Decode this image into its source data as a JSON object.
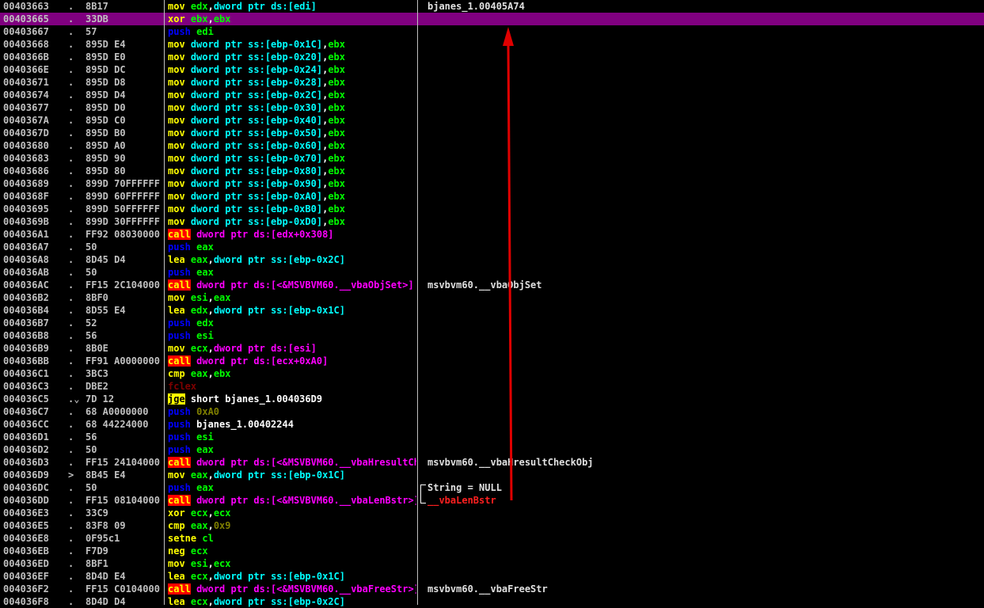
{
  "rows": [
    {
      "addr": "00403663",
      "mark": ".",
      "hex": "8B17",
      "asm": [
        [
          "mov ",
          "mov"
        ],
        [
          "edx",
          "reg"
        ],
        [
          ",",
          "plain"
        ],
        [
          "dword ptr ds:[edi]",
          "mem"
        ]
      ],
      "cmt": [
        [
          "bjanes_1.00405A74",
          "cmt"
        ]
      ]
    },
    {
      "addr": "00403665",
      "mark": ".",
      "hex": "33DB",
      "sel": true,
      "asm": [
        [
          "xor ",
          "mov"
        ],
        [
          "ebx",
          "reg"
        ],
        [
          ",",
          "plain"
        ],
        [
          "ebx",
          "reg"
        ]
      ],
      "cmt": []
    },
    {
      "addr": "00403667",
      "mark": ".",
      "hex": "57",
      "asm": [
        [
          "push ",
          "push"
        ],
        [
          "edi",
          "reg"
        ]
      ],
      "cmt": []
    },
    {
      "addr": "00403668",
      "mark": ".",
      "hex": "895D E4",
      "asm": [
        [
          "mov ",
          "mov"
        ],
        [
          "dword ptr ss:[ebp-0x1C]",
          "mem"
        ],
        [
          ",",
          "plain"
        ],
        [
          "ebx",
          "reg"
        ]
      ],
      "cmt": []
    },
    {
      "addr": "0040366B",
      "mark": ".",
      "hex": "895D E0",
      "asm": [
        [
          "mov ",
          "mov"
        ],
        [
          "dword ptr ss:[ebp-0x20]",
          "mem"
        ],
        [
          ",",
          "plain"
        ],
        [
          "ebx",
          "reg"
        ]
      ],
      "cmt": []
    },
    {
      "addr": "0040366E",
      "mark": ".",
      "hex": "895D DC",
      "asm": [
        [
          "mov ",
          "mov"
        ],
        [
          "dword ptr ss:[ebp-0x24]",
          "mem"
        ],
        [
          ",",
          "plain"
        ],
        [
          "ebx",
          "reg"
        ]
      ],
      "cmt": []
    },
    {
      "addr": "00403671",
      "mark": ".",
      "hex": "895D D8",
      "asm": [
        [
          "mov ",
          "mov"
        ],
        [
          "dword ptr ss:[ebp-0x28]",
          "mem"
        ],
        [
          ",",
          "plain"
        ],
        [
          "ebx",
          "reg"
        ]
      ],
      "cmt": []
    },
    {
      "addr": "00403674",
      "mark": ".",
      "hex": "895D D4",
      "asm": [
        [
          "mov ",
          "mov"
        ],
        [
          "dword ptr ss:[ebp-0x2C]",
          "mem"
        ],
        [
          ",",
          "plain"
        ],
        [
          "ebx",
          "reg"
        ]
      ],
      "cmt": []
    },
    {
      "addr": "00403677",
      "mark": ".",
      "hex": "895D D0",
      "asm": [
        [
          "mov ",
          "mov"
        ],
        [
          "dword ptr ss:[ebp-0x30]",
          "mem"
        ],
        [
          ",",
          "plain"
        ],
        [
          "ebx",
          "reg"
        ]
      ],
      "cmt": []
    },
    {
      "addr": "0040367A",
      "mark": ".",
      "hex": "895D C0",
      "asm": [
        [
          "mov ",
          "mov"
        ],
        [
          "dword ptr ss:[ebp-0x40]",
          "mem"
        ],
        [
          ",",
          "plain"
        ],
        [
          "ebx",
          "reg"
        ]
      ],
      "cmt": []
    },
    {
      "addr": "0040367D",
      "mark": ".",
      "hex": "895D B0",
      "asm": [
        [
          "mov ",
          "mov"
        ],
        [
          "dword ptr ss:[ebp-0x50]",
          "mem"
        ],
        [
          ",",
          "plain"
        ],
        [
          "ebx",
          "reg"
        ]
      ],
      "cmt": []
    },
    {
      "addr": "00403680",
      "mark": ".",
      "hex": "895D A0",
      "asm": [
        [
          "mov ",
          "mov"
        ],
        [
          "dword ptr ss:[ebp-0x60]",
          "mem"
        ],
        [
          ",",
          "plain"
        ],
        [
          "ebx",
          "reg"
        ]
      ],
      "cmt": []
    },
    {
      "addr": "00403683",
      "mark": ".",
      "hex": "895D 90",
      "asm": [
        [
          "mov ",
          "mov"
        ],
        [
          "dword ptr ss:[ebp-0x70]",
          "mem"
        ],
        [
          ",",
          "plain"
        ],
        [
          "ebx",
          "reg"
        ]
      ],
      "cmt": []
    },
    {
      "addr": "00403686",
      "mark": ".",
      "hex": "895D 80",
      "asm": [
        [
          "mov ",
          "mov"
        ],
        [
          "dword ptr ss:[ebp-0x80]",
          "mem"
        ],
        [
          ",",
          "plain"
        ],
        [
          "ebx",
          "reg"
        ]
      ],
      "cmt": []
    },
    {
      "addr": "00403689",
      "mark": ".",
      "hex": "899D 70FFFFFF",
      "asm": [
        [
          "mov ",
          "mov"
        ],
        [
          "dword ptr ss:[ebp-0x90]",
          "mem"
        ],
        [
          ",",
          "plain"
        ],
        [
          "ebx",
          "reg"
        ]
      ],
      "cmt": []
    },
    {
      "addr": "0040368F",
      "mark": ".",
      "hex": "899D 60FFFFFF",
      "asm": [
        [
          "mov ",
          "mov"
        ],
        [
          "dword ptr ss:[ebp-0xA0]",
          "mem"
        ],
        [
          ",",
          "plain"
        ],
        [
          "ebx",
          "reg"
        ]
      ],
      "cmt": []
    },
    {
      "addr": "00403695",
      "mark": ".",
      "hex": "899D 50FFFFFF",
      "asm": [
        [
          "mov ",
          "mov"
        ],
        [
          "dword ptr ss:[ebp-0xB0]",
          "mem"
        ],
        [
          ",",
          "plain"
        ],
        [
          "ebx",
          "reg"
        ]
      ],
      "cmt": []
    },
    {
      "addr": "0040369B",
      "mark": ".",
      "hex": "899D 30FFFFFF",
      "asm": [
        [
          "mov ",
          "mov"
        ],
        [
          "dword ptr ss:[ebp-0xD0]",
          "mem"
        ],
        [
          ",",
          "plain"
        ],
        [
          "ebx",
          "reg"
        ]
      ],
      "cmt": []
    },
    {
      "addr": "004036A1",
      "mark": ".",
      "hex": "FF92 08030000",
      "asm": [
        [
          "call",
          "call"
        ],
        [
          " ",
          "plain"
        ],
        [
          "dword ptr ds:[edx+0x308]",
          "api"
        ]
      ],
      "cmt": []
    },
    {
      "addr": "004036A7",
      "mark": ".",
      "hex": "50",
      "asm": [
        [
          "push ",
          "push"
        ],
        [
          "eax",
          "reg"
        ]
      ],
      "cmt": []
    },
    {
      "addr": "004036A8",
      "mark": ".",
      "hex": "8D45 D4",
      "asm": [
        [
          "lea ",
          "mov"
        ],
        [
          "eax",
          "reg"
        ],
        [
          ",",
          "plain"
        ],
        [
          "dword ptr ss:[ebp-0x2C]",
          "mem"
        ]
      ],
      "cmt": []
    },
    {
      "addr": "004036AB",
      "mark": ".",
      "hex": "50",
      "asm": [
        [
          "push ",
          "push"
        ],
        [
          "eax",
          "reg"
        ]
      ],
      "cmt": []
    },
    {
      "addr": "004036AC",
      "mark": ".",
      "hex": "FF15 2C104000",
      "asm": [
        [
          "call",
          "call"
        ],
        [
          " ",
          "plain"
        ],
        [
          "dword ptr ds:[<&MSVBVM60.__vbaObjSet>]",
          "api"
        ]
      ],
      "cmt": [
        [
          "msvbvm60.__vbaObjSet",
          "cmt"
        ]
      ]
    },
    {
      "addr": "004036B2",
      "mark": ".",
      "hex": "8BF0",
      "asm": [
        [
          "mov ",
          "mov"
        ],
        [
          "esi",
          "reg"
        ],
        [
          ",",
          "plain"
        ],
        [
          "eax",
          "reg"
        ]
      ],
      "cmt": []
    },
    {
      "addr": "004036B4",
      "mark": ".",
      "hex": "8D55 E4",
      "asm": [
        [
          "lea ",
          "mov"
        ],
        [
          "edx",
          "reg"
        ],
        [
          ",",
          "plain"
        ],
        [
          "dword ptr ss:[ebp-0x1C]",
          "mem"
        ]
      ],
      "cmt": []
    },
    {
      "addr": "004036B7",
      "mark": ".",
      "hex": "52",
      "asm": [
        [
          "push ",
          "push"
        ],
        [
          "edx",
          "reg"
        ]
      ],
      "cmt": []
    },
    {
      "addr": "004036B8",
      "mark": ".",
      "hex": "56",
      "asm": [
        [
          "push ",
          "push"
        ],
        [
          "esi",
          "reg"
        ]
      ],
      "cmt": []
    },
    {
      "addr": "004036B9",
      "mark": ".",
      "hex": "8B0E",
      "asm": [
        [
          "mov ",
          "mov"
        ],
        [
          "ecx",
          "reg"
        ],
        [
          ",",
          "plain"
        ],
        [
          "dword ptr ds:[esi]",
          "api"
        ]
      ],
      "cmt": []
    },
    {
      "addr": "004036BB",
      "mark": ".",
      "hex": "FF91 A0000000",
      "asm": [
        [
          "call",
          "call"
        ],
        [
          " ",
          "plain"
        ],
        [
          "dword ptr ds:[ecx+0xA0]",
          "api"
        ]
      ],
      "cmt": []
    },
    {
      "addr": "004036C1",
      "mark": ".",
      "hex": "3BC3",
      "asm": [
        [
          "cmp ",
          "mov"
        ],
        [
          "eax",
          "reg"
        ],
        [
          ",",
          "plain"
        ],
        [
          "ebx",
          "reg"
        ]
      ],
      "cmt": []
    },
    {
      "addr": "004036C3",
      "mark": ".",
      "hex": "DBE2",
      "asm": [
        [
          "fclex",
          "fpu"
        ]
      ],
      "cmt": []
    },
    {
      "addr": "004036C5",
      "mark": ".⌄",
      "hex": "7D 12",
      "asm": [
        [
          "jge",
          "jcc"
        ],
        [
          " short bjanes_1.004036D9",
          "std"
        ]
      ],
      "cmt": []
    },
    {
      "addr": "004036C7",
      "mark": ".",
      "hex": "68 A0000000",
      "asm": [
        [
          "push ",
          "push"
        ],
        [
          "0xA0",
          "imm"
        ]
      ],
      "cmt": []
    },
    {
      "addr": "004036CC",
      "mark": ".",
      "hex": "68 44224000",
      "asm": [
        [
          "push ",
          "push"
        ],
        [
          "bjanes_1.00402244",
          "std"
        ]
      ],
      "cmt": []
    },
    {
      "addr": "004036D1",
      "mark": ".",
      "hex": "56",
      "asm": [
        [
          "push ",
          "push"
        ],
        [
          "esi",
          "reg"
        ]
      ],
      "cmt": []
    },
    {
      "addr": "004036D2",
      "mark": ".",
      "hex": "50",
      "asm": [
        [
          "push ",
          "push"
        ],
        [
          "eax",
          "reg"
        ]
      ],
      "cmt": []
    },
    {
      "addr": "004036D3",
      "mark": ".",
      "hex": "FF15 24104000",
      "asm": [
        [
          "call",
          "call"
        ],
        [
          " ",
          "plain"
        ],
        [
          "dword ptr ds:[<&MSVBVM60.__vbaHresultCheckObj>]",
          "api"
        ]
      ],
      "cmt": [
        [
          "msvbvm60.__vbaHresultCheckObj",
          "cmt"
        ]
      ]
    },
    {
      "addr": "004036D9",
      "mark": ">",
      "hex": "8B45 E4",
      "asm": [
        [
          "mov ",
          "mov"
        ],
        [
          "eax",
          "reg"
        ],
        [
          ",",
          "plain"
        ],
        [
          "dword ptr ss:[ebp-0x1C]",
          "mem"
        ]
      ],
      "cmt": []
    },
    {
      "addr": "004036DC",
      "mark": ".",
      "hex": "50",
      "asm": [
        [
          "push ",
          "push"
        ],
        [
          "eax",
          "reg"
        ]
      ],
      "cmt": [
        [
          "String = NULL",
          "cmt"
        ]
      ]
    },
    {
      "addr": "004036DD",
      "mark": ".",
      "hex": "FF15 08104000",
      "asm": [
        [
          "call",
          "call"
        ],
        [
          " ",
          "plain"
        ],
        [
          "dword ptr ds:[<&MSVBVM60.__vbaLenBstr>]",
          "api"
        ]
      ],
      "cmt": [
        [
          "__vbaLenBstr",
          "cmtred"
        ]
      ]
    },
    {
      "addr": "004036E3",
      "mark": ".",
      "hex": "33C9",
      "asm": [
        [
          "xor ",
          "mov"
        ],
        [
          "ecx",
          "reg"
        ],
        [
          ",",
          "plain"
        ],
        [
          "ecx",
          "reg"
        ]
      ],
      "cmt": []
    },
    {
      "addr": "004036E5",
      "mark": ".",
      "hex": "83F8 09",
      "asm": [
        [
          "cmp ",
          "mov"
        ],
        [
          "eax",
          "reg"
        ],
        [
          ",",
          "plain"
        ],
        [
          "0x9",
          "imm"
        ]
      ],
      "cmt": []
    },
    {
      "addr": "004036E8",
      "mark": ".",
      "hex": "0F95c1",
      "asm": [
        [
          "setne ",
          "mov"
        ],
        [
          "cl",
          "reg"
        ]
      ],
      "cmt": []
    },
    {
      "addr": "004036EB",
      "mark": ".",
      "hex": "F7D9",
      "asm": [
        [
          "neg ",
          "mov"
        ],
        [
          "ecx",
          "reg"
        ]
      ],
      "cmt": []
    },
    {
      "addr": "004036ED",
      "mark": ".",
      "hex": "8BF1",
      "asm": [
        [
          "mov ",
          "mov"
        ],
        [
          "esi",
          "reg"
        ],
        [
          ",",
          "plain"
        ],
        [
          "ecx",
          "reg"
        ]
      ],
      "cmt": []
    },
    {
      "addr": "004036EF",
      "mark": ".",
      "hex": "8D4D E4",
      "asm": [
        [
          "lea ",
          "mov"
        ],
        [
          "ecx",
          "reg"
        ],
        [
          ",",
          "plain"
        ],
        [
          "dword ptr ss:[ebp-0x1C]",
          "mem"
        ]
      ],
      "cmt": []
    },
    {
      "addr": "004036F2",
      "mark": ".",
      "hex": "FF15 C0104000",
      "asm": [
        [
          "call",
          "call"
        ],
        [
          " ",
          "plain"
        ],
        [
          "dword ptr ds:[<&MSVBVM60.__vbaFreeStr>]",
          "api"
        ]
      ],
      "cmt": [
        [
          "msvbvm60.__vbaFreeStr",
          "cmt"
        ]
      ]
    },
    {
      "addr": "004036F8",
      "mark": ".",
      "hex": "8D4D D4",
      "asm": [
        [
          "lea ",
          "mov"
        ],
        [
          "ecx",
          "reg"
        ],
        [
          ",",
          "plain"
        ],
        [
          "dword ptr ss:[ebp-0x2C]",
          "mem"
        ]
      ],
      "cmt": []
    }
  ],
  "colors": {
    "selection": "#800080",
    "annotation_arrow": "#e00000"
  },
  "annotation": {
    "type": "arrow",
    "from_row": "004036DD",
    "to_row": "00403665"
  }
}
